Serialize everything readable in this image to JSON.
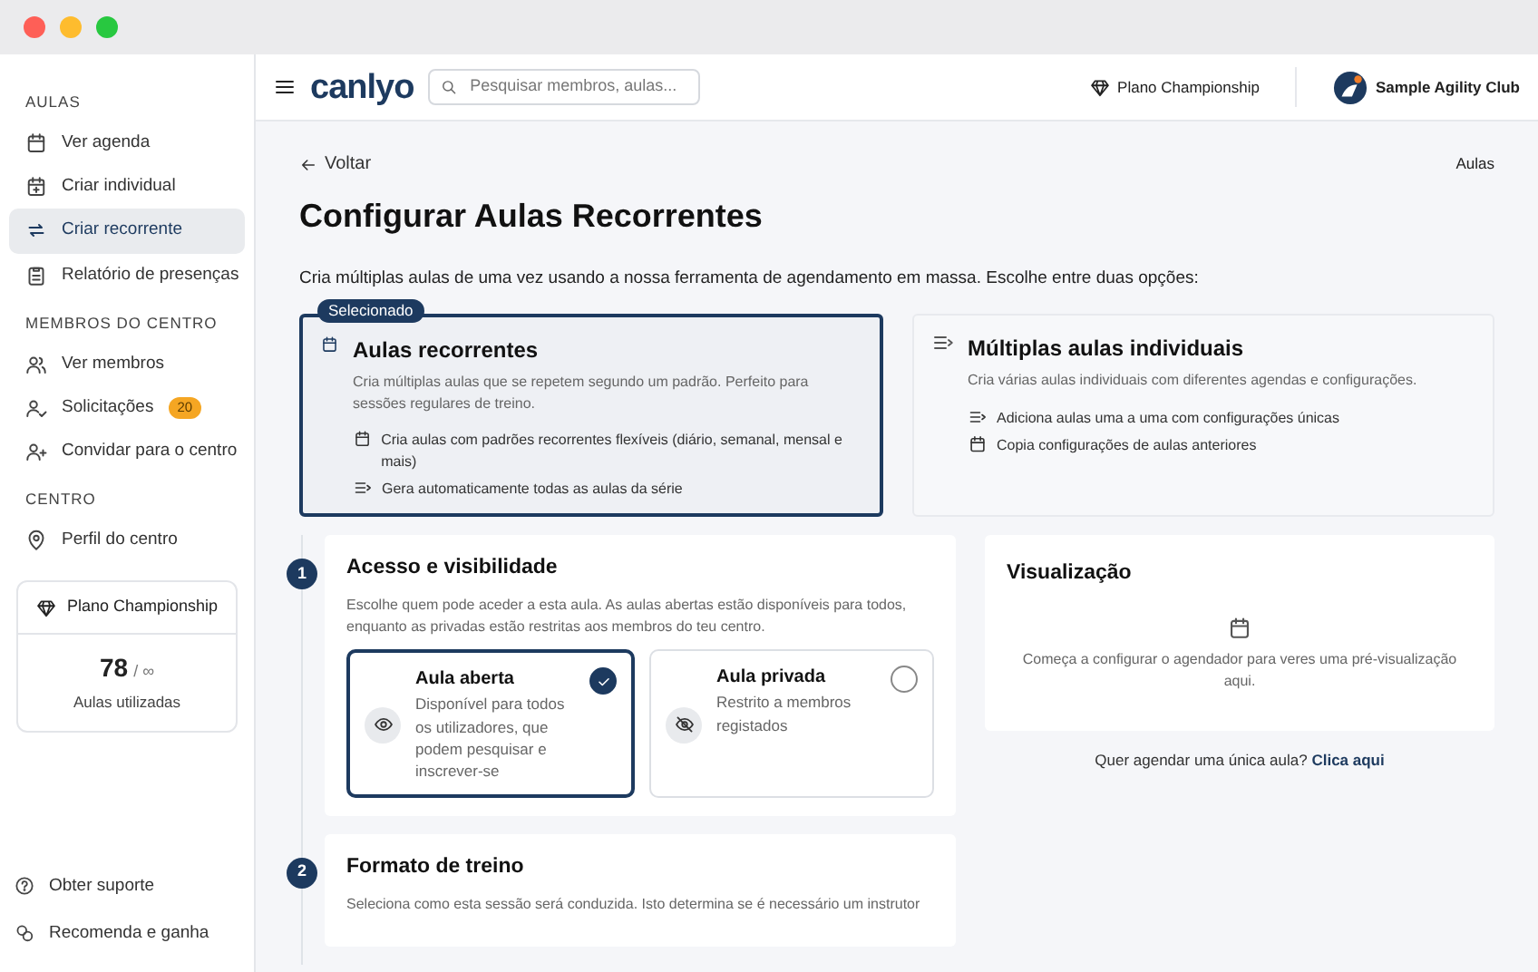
{
  "sidebar": {
    "sections": [
      {
        "heading": "AULAS",
        "items": [
          {
            "label": "Ver agenda",
            "selected": false
          },
          {
            "label": "Criar individual",
            "selected": false
          },
          {
            "label": "Criar recorrente",
            "selected": true
          },
          {
            "label": "Relatório de presenças",
            "selected": false
          }
        ]
      },
      {
        "heading": "MEMBROS DO CENTRO",
        "items": [
          {
            "label": "Ver membros",
            "selected": false
          },
          {
            "label": "Solicitações",
            "selected": false,
            "badge": "20"
          },
          {
            "label": "Convidar para o centro",
            "selected": false
          }
        ]
      },
      {
        "heading": "CENTRO",
        "items": [
          {
            "label": "Perfil do centro",
            "selected": false
          }
        ]
      }
    ],
    "plan_card": {
      "title": "Plano Championship",
      "count": "78",
      "limit": "/ ∞",
      "caption": "Aulas utilizadas"
    },
    "footer_links": [
      "Obter suporte",
      "Recomenda e ganha"
    ]
  },
  "top_bar": {
    "logo": "canlyo",
    "search": {
      "placeholder": "Pesquisar membros, aulas..."
    },
    "plan": "Plano Championship",
    "club": "Sample Agility Club"
  },
  "back_link": "Voltar",
  "breadcrumb": "Aulas",
  "title": "Configurar Aulas Recorrentes",
  "intro": "Cria múltiplas aulas de uma vez usando a nossa ferramenta de agendamento em massa. Escolhe entre duas opções:",
  "options": [
    {
      "title": "Aulas recorrentes",
      "badge": "Selecionado",
      "selected": true,
      "description": "Cria múltiplas aulas que se repetem segundo um padrão. Perfeito para sessões regulares de treino.",
      "features": [
        "Cria aulas com padrões recorrentes flexíveis (diário, semanal, mensal e mais)",
        "Gera automaticamente todas as aulas da série"
      ]
    },
    {
      "title": "Múltiplas aulas individuais",
      "selected": false,
      "description": "Cria várias aulas individuais com diferentes agendas e configurações.",
      "features": [
        "Adiciona aulas uma a uma com configurações únicas",
        "Copia configurações de aulas anteriores"
      ]
    }
  ],
  "steps": [
    {
      "number": "1",
      "title": "Acesso e visibilidade",
      "description": "Escolhe quem pode aceder a esta aula. As aulas abertas estão disponíveis para todos, enquanto as privadas estão restritas aos membros do teu centro.",
      "choices": [
        {
          "title": "Aula aberta",
          "description": "Disponível para todos os utilizadores, que podem pesquisar e inscrever-se",
          "selected": true
        },
        {
          "title": "Aula privada",
          "description": "Restrito a membros registados",
          "selected": false
        }
      ]
    },
    {
      "number": "2",
      "title": "Formato de treino",
      "description": "Seleciona como esta sessão será conduzida. Isto determina se é necessário um instrutor"
    }
  ],
  "preview": {
    "title": "Visualização",
    "text": "Começa a configurar o agendador para veres uma pré-visualização aqui."
  },
  "single_class": {
    "text": "Quer agendar uma única aula?",
    "link": "Clica aqui"
  }
}
